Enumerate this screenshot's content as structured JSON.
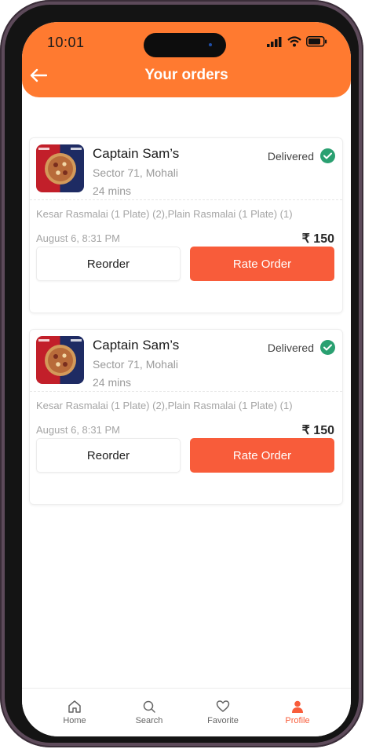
{
  "status_bar": {
    "time": "10:01"
  },
  "header": {
    "title": "Your orders"
  },
  "orders": [
    {
      "restaurant": "Captain Sam’s",
      "location": "Sector 71, Mohali",
      "eta": "24 mins",
      "status": "Delivered",
      "items": "Kesar Rasmalai (1 Plate) (2),Plain Rasmalai (1 Plate) (1)",
      "date": "August 6, 8:31 PM",
      "price": "₹ 150",
      "reorder_label": "Reorder",
      "rate_label": "Rate Order"
    },
    {
      "restaurant": "Captain Sam’s",
      "location": "Sector 71, Mohali",
      "eta": "24 mins",
      "status": "Delivered",
      "items": "Kesar Rasmalai (1 Plate) (2),Plain Rasmalai (1 Plate) (1)",
      "date": "August 6, 8:31 PM",
      "price": "₹ 150",
      "reorder_label": "Reorder",
      "rate_label": "Rate Order"
    }
  ],
  "bottom_nav": [
    {
      "label": "Home",
      "icon": "home-icon"
    },
    {
      "label": "Search",
      "icon": "search-icon"
    },
    {
      "label": "Favorite",
      "icon": "heart-icon"
    },
    {
      "label": "Profile",
      "icon": "profile-icon",
      "active": true
    }
  ],
  "colors": {
    "header": "#ff7a30",
    "accent": "#f85c3a",
    "delivered": "#2aa071"
  }
}
